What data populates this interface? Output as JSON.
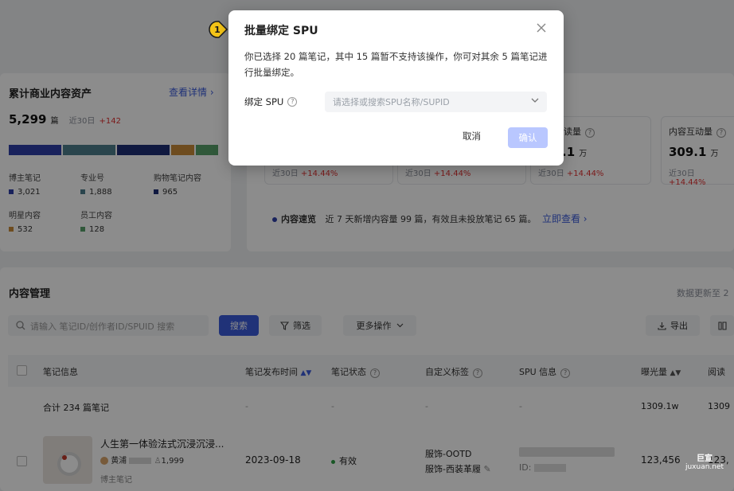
{
  "asset_card": {
    "title": "累计商业内容资产",
    "detail_link": "查看详情 ›",
    "total": "5,299",
    "total_unit": "篇",
    "recent_label": "近30日",
    "recent_delta": "+142",
    "legend": [
      {
        "label": "博主笔记",
        "value": "3,021",
        "color": "#2f3fa8"
      },
      {
        "label": "专业号",
        "value": "1,888",
        "color": "#4e7f8c"
      },
      {
        "label": "购物笔记内容",
        "value": "965",
        "color": "#1e2f75"
      },
      {
        "label": "明星内容",
        "value": "532",
        "color": "#c98a3a"
      },
      {
        "label": "员工内容",
        "value": "128",
        "color": "#58a06a"
      }
    ]
  },
  "metrics": [
    {
      "label": "读量",
      "value": ".1",
      "unit": "万",
      "recent": "近30日",
      "delta": "+14.44%"
    },
    {
      "label": "内容互动量",
      "value": "309.1",
      "unit": "万",
      "recent": "近30日",
      "delta": "+14.44%"
    }
  ],
  "metric_deltas": [
    "近30日",
    "+14.44%",
    "近30日",
    "+14.44%"
  ],
  "quick_view": {
    "label": "内容速览",
    "text": "近 7 天新增内容量 99 篇，有效且未投放笔记 65 篇。",
    "link": "立即查看 ›"
  },
  "content_mgmt": {
    "title": "内容管理",
    "updated": "数据更新至 2",
    "search_placeholder": "请输入 笔记ID/创作者ID/SPUID 搜索",
    "search_btn": "搜索",
    "filter_btn": "筛选",
    "more_btn": "更多操作",
    "export_btn": "导出",
    "columns": [
      "笔记信息",
      "笔记发布时间",
      "笔记状态",
      "自定义标签",
      "SPU 信息",
      "曝光量",
      "阅读"
    ],
    "summary": {
      "label": "合计 234 篇笔记",
      "dashes": [
        "-",
        "-",
        "-",
        "-"
      ],
      "exposure": "1309.1w",
      "read": "1309"
    },
    "row": {
      "title": "人生第一体验法式沉浸沉浸...",
      "author": "黄浦",
      "fans": "1,999",
      "type": "博主笔记",
      "date": "2023-09-18",
      "status": "有效",
      "tag1": "服饰-OOTD",
      "tag2": "服饰-西装革履",
      "spu_id": "ID:",
      "exposure": "123,456",
      "read": "123,"
    }
  },
  "modal": {
    "step": "1",
    "title": "批量绑定 SPU",
    "description": "你已选择 20 篇笔记，其中 15 篇暂不支持该操作，你可对其余 5 篇笔记进行批量绑定。",
    "field_label": "绑定 SPU",
    "select_placeholder": "请选择或搜索SPU名称/SUPID",
    "cancel": "取消",
    "confirm": "确认"
  },
  "watermark": {
    "line1": "巨宣",
    "line2": "juxuan.net"
  }
}
